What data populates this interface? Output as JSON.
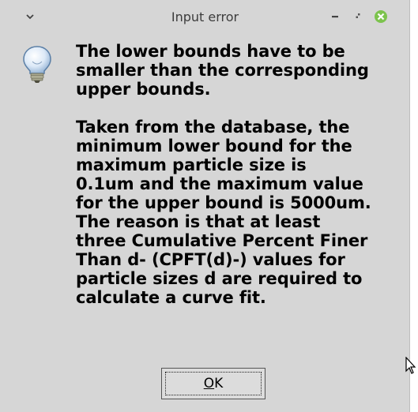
{
  "window": {
    "title": "Input error"
  },
  "titlebar": {
    "menu_icon": "chevron-down-icon",
    "minimize_icon": "minimize-icon",
    "maximize_icon": "maximize-icon",
    "close_icon": "close-icon",
    "close_color": "#7cc34d"
  },
  "dialog": {
    "icon": "lightbulb-icon",
    "message": "The lower bounds have to be\nsmaller than the corresponding\nupper bounds.\n\nTaken from the database, the\nminimum lower bound for the\nmaximum particle size is\n0.1um and the maximum value\nfor the upper bound is 5000um.\nThe reason is that at least\nthree Cumulative Percent Finer\nThan d- (CPFT(d)-) values for\nparticle sizes d are required to\ncalculate a curve fit.",
    "ok_mnemonic": "O",
    "ok_rest": "K"
  }
}
